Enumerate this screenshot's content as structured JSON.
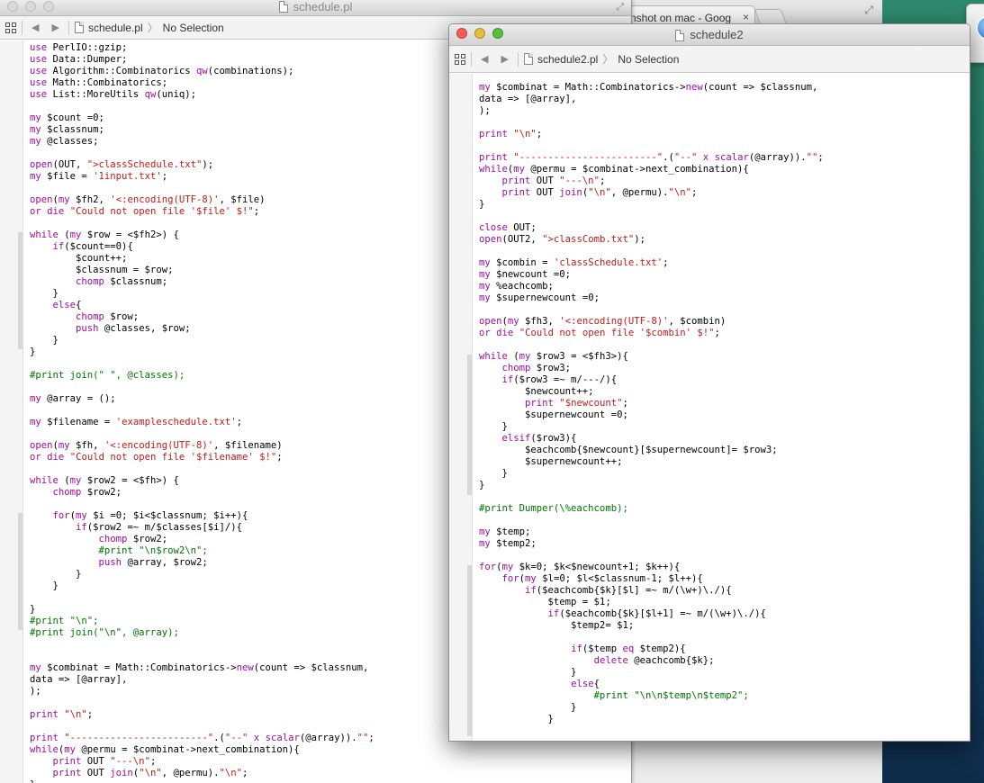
{
  "browser": {
    "tab_title": "nshot on mac - Goog",
    "tab_close": "×"
  },
  "editor1": {
    "window_title": "schedule.pl",
    "breadcrumb_file": "schedule.pl",
    "breadcrumb_selection": "No Selection",
    "nav_back": "◀",
    "nav_forward": "▶",
    "code_lines": [
      "use PerlIO::gzip;",
      "use Data::Dumper;",
      "use Algorithm::Combinatorics qw(combinations);",
      "use Math::Combinatorics;",
      "use List::MoreUtils qw(uniq);",
      "",
      "my $count =0;",
      "my $classnum;",
      "my @classes;",
      "",
      "open(OUT, \">classSchedule.txt\");",
      "my $file = '1input.txt';",
      "",
      "open(my $fh2, '<:encoding(UTF-8)', $file)",
      "or die \"Could not open file '$file' $!\";",
      "",
      "while (my $row = <$fh2>) {",
      "    if($count==0){",
      "        $count++;",
      "        $classnum = $row;",
      "        chomp $classnum;",
      "    }",
      "    else{",
      "        chomp $row;",
      "        push @classes, $row;",
      "    }",
      "}",
      "",
      "#print join(\" \", @classes);",
      "",
      "my @array = ();",
      "",
      "my $filename = 'exampleschedule.txt';",
      "",
      "open(my $fh, '<:encoding(UTF-8)', $filename)",
      "or die \"Could not open file '$filename' $!\";",
      "",
      "while (my $row2 = <$fh>) {",
      "    chomp $row2;",
      "",
      "    for(my $i =0; $i<$classnum; $i++){",
      "        if($row2 =~ m/$classes[$i]/){",
      "            chomp $row2;",
      "            #print \"\\n$row2\\n\";",
      "            push @array, $row2;",
      "        }",
      "    }",
      "",
      "}",
      "#print \"\\n\";",
      "#print join(\"\\n\", @array);",
      "",
      "",
      "my $combinat = Math::Combinatorics->new(count => $classnum,",
      "data => [@array],",
      ");",
      "",
      "print \"\\n\";",
      "",
      "print \"------------------------\".(\"--\" x scalar(@array)).\"\";",
      "while(my @permu = $combinat->next_combination){",
      "    print OUT \"---\\n\";",
      "    print OUT join(\"\\n\", @permu).\"\\n\";",
      "}"
    ]
  },
  "editor2": {
    "window_title": "schedule2",
    "breadcrumb_file": "schedule2.pl",
    "breadcrumb_selection": "No Selection",
    "nav_back": "◀",
    "nav_forward": "▶",
    "code_lines": [
      "my $combinat = Math::Combinatorics->new(count => $classnum,",
      "data => [@array],",
      ");",
      "",
      "print \"\\n\";",
      "",
      "print \"------------------------\".(\"--\" x scalar(@array)).\"\";",
      "while(my @permu = $combinat->next_combination){",
      "    print OUT \"---\\n\";",
      "    print OUT join(\"\\n\", @permu).\"\\n\";",
      "}",
      "",
      "close OUT;",
      "open(OUT2, \">classComb.txt\");",
      "",
      "my $combin = 'classSchedule.txt';",
      "my $newcount =0;",
      "my %eachcomb;",
      "my $supernewcount =0;",
      "",
      "open(my $fh3, '<:encoding(UTF-8)', $combin)",
      "or die \"Could not open file '$combin' $!\";",
      "",
      "while (my $row3 = <$fh3>){",
      "    chomp $row3;",
      "    if($row3 =~ m/---/){",
      "        $newcount++;",
      "        print \"$newcount\";",
      "        $supernewcount =0;",
      "    }",
      "    elsif($row3){",
      "        $eachcomb{$newcount}[$supernewcount]= $row3;",
      "        $supernewcount++;",
      "    }",
      "}",
      "",
      "#print Dumper(\\%eachcomb);",
      "",
      "my $temp;",
      "my $temp2;",
      "",
      "for(my $k=0; $k<$newcount+1; $k++){",
      "    for(my $l=0; $l<$classnum-1; $l++){",
      "        if($eachcomb{$k}[$l] =~ m/(\\w+)\\./){",
      "            $temp = $1;",
      "            if($eachcomb{$k}[$l+1] =~ m/(\\w+)\\./){",
      "                $temp2= $1;",
      "",
      "                if($temp eq $temp2){",
      "                    delete @eachcomb{$k};",
      "                }",
      "                else{",
      "                    #print \"\\n\\n$temp\\n$temp2\";",
      "                }",
      "            }"
    ]
  },
  "colors": {
    "keyword": "#a00ca0",
    "string": "#c41a16",
    "comment": "#007400"
  }
}
